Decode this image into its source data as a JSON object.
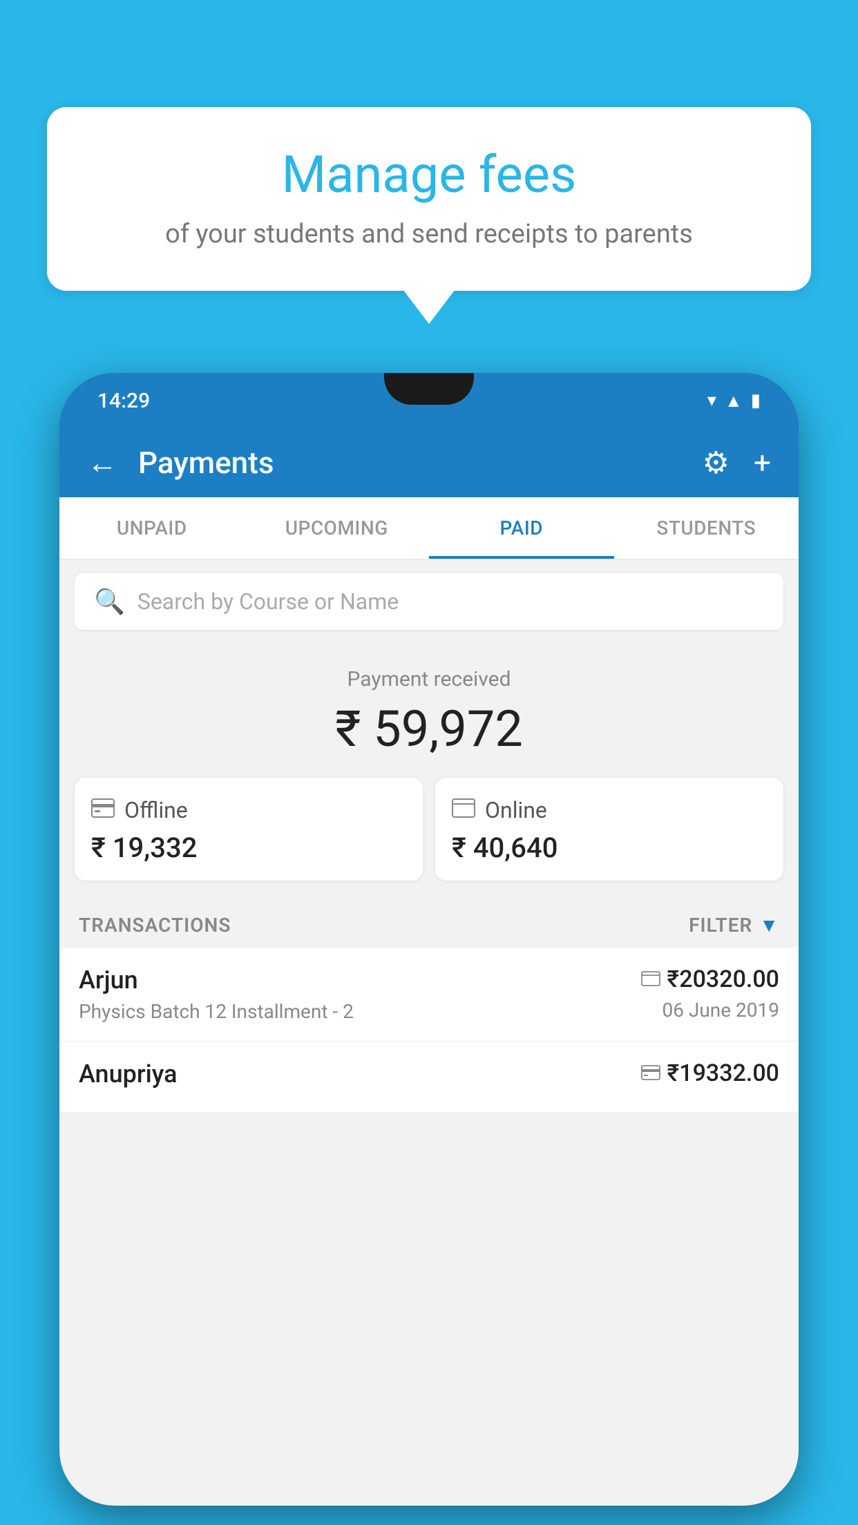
{
  "page": {
    "background_color": "#29b6e8"
  },
  "speech_bubble": {
    "title": "Manage fees",
    "subtitle": "of your students and send receipts to parents"
  },
  "phone": {
    "status_bar": {
      "time": "14:29"
    },
    "app_header": {
      "title": "Payments",
      "back_icon": "←",
      "settings_icon": "⚙",
      "add_icon": "+"
    },
    "tabs": [
      {
        "label": "UNPAID",
        "active": false
      },
      {
        "label": "UPCOMING",
        "active": false
      },
      {
        "label": "PAID",
        "active": true
      },
      {
        "label": "STUDENTS",
        "active": false
      }
    ],
    "search": {
      "placeholder": "Search by Course or Name"
    },
    "payment_received": {
      "label": "Payment received",
      "amount": "₹ 59,972"
    },
    "payment_cards": [
      {
        "icon": "💳",
        "label": "Offline",
        "amount": "₹ 19,332"
      },
      {
        "icon": "💳",
        "label": "Online",
        "amount": "₹ 40,640"
      }
    ],
    "transactions": {
      "label": "TRANSACTIONS",
      "filter_label": "FILTER"
    },
    "transaction_rows": [
      {
        "name": "Arjun",
        "detail": "Physics Batch 12 Installment - 2",
        "amount": "₹20320.00",
        "date": "06 June 2019",
        "payment_type": "online"
      },
      {
        "name": "Anupriya",
        "detail": "",
        "amount": "₹19332.00",
        "date": "",
        "payment_type": "offline"
      }
    ]
  }
}
